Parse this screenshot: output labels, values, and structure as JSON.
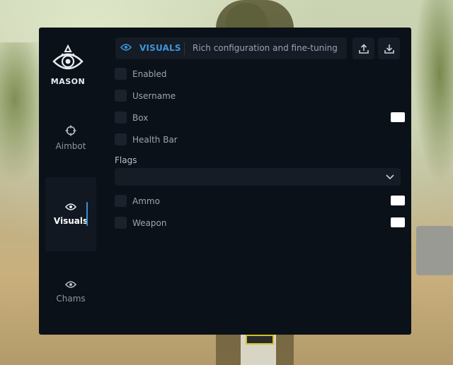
{
  "brand": {
    "name": "MASON"
  },
  "sidebar": {
    "items": [
      {
        "label": "Aimbot",
        "icon": "crosshair-icon",
        "active": false
      },
      {
        "label": "Visuals",
        "icon": "eye-icon",
        "active": true
      },
      {
        "label": "Chams",
        "icon": "eye-icon",
        "active": false
      }
    ]
  },
  "header": {
    "title": "VISUALS",
    "subtitle": "Rich configuration and fine-tuning",
    "actions": {
      "export_icon": "upload-icon",
      "import_icon": "download-icon"
    }
  },
  "options": [
    {
      "label": "Enabled",
      "checked": false,
      "color": null
    },
    {
      "label": "Username",
      "checked": false,
      "color": null
    },
    {
      "label": "Box",
      "checked": false,
      "color": "#ffffff"
    },
    {
      "label": "Health Bar",
      "checked": false,
      "color": null
    }
  ],
  "flags": {
    "label": "Flags",
    "selected": "",
    "options": [
      {
        "label": "Ammo",
        "checked": false,
        "color": "#ffffff"
      },
      {
        "label": "Weapon",
        "checked": false,
        "color": "#ffffff"
      }
    ]
  },
  "colors": {
    "accent": "#3b8fd6",
    "panel": "#0b1118",
    "control": "#151c25"
  }
}
